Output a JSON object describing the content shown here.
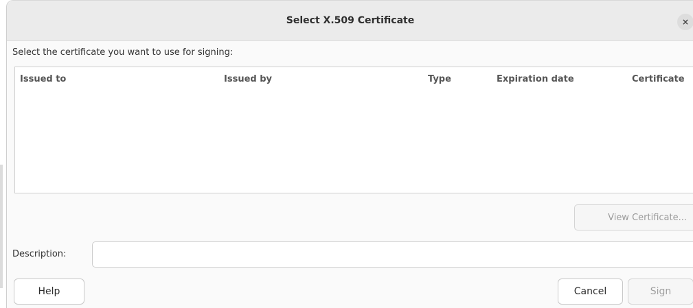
{
  "dialog": {
    "title": "Select X.509 Certificate",
    "close_glyph": "×"
  },
  "prompt": "Select the certificate you want to use for signing:",
  "table": {
    "columns": [
      "Issued to",
      "Issued by",
      "Type",
      "Expiration date",
      "Certificate"
    ],
    "rows": []
  },
  "buttons": {
    "view_certificate": "View Certificate...",
    "help": "Help",
    "cancel": "Cancel",
    "sign": "Sign"
  },
  "description": {
    "label": "Description:",
    "value": ""
  }
}
